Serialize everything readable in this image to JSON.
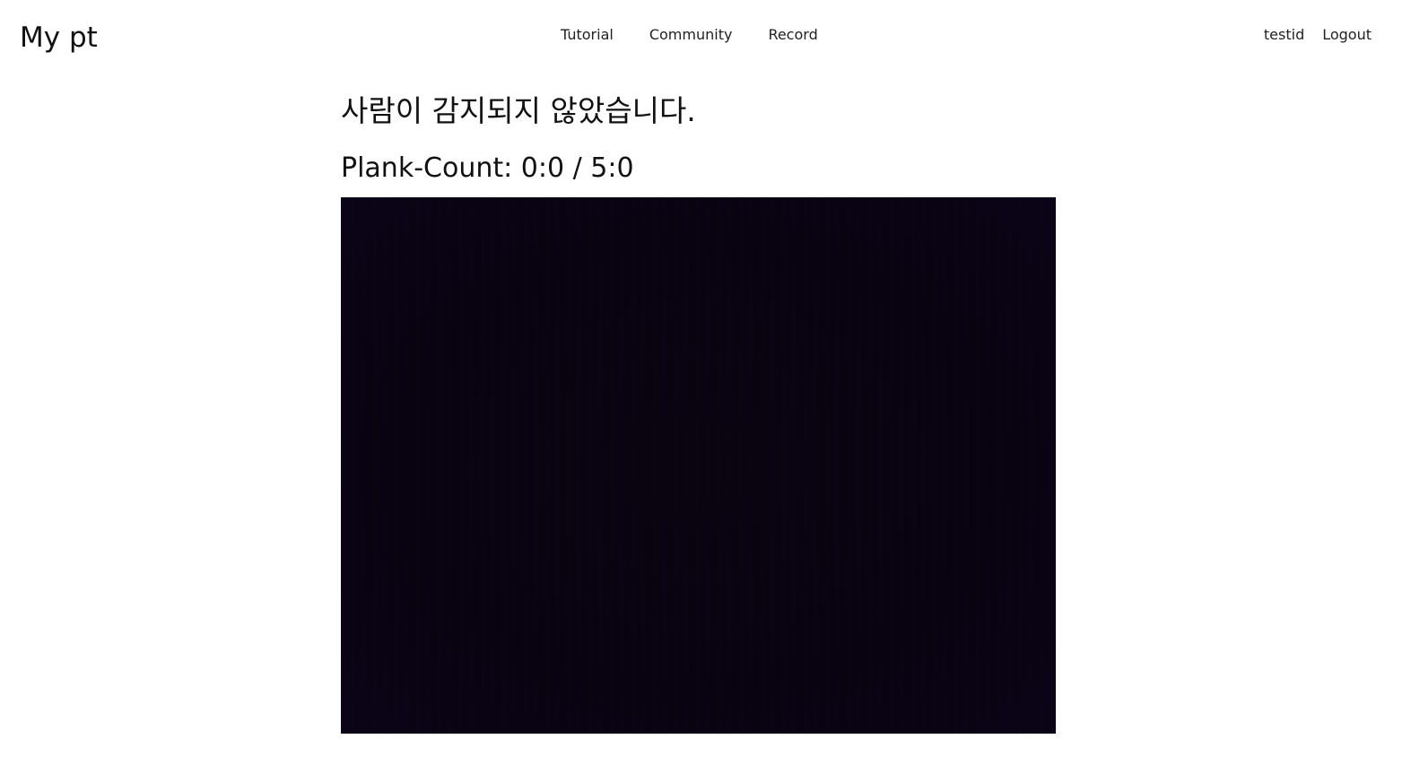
{
  "navbar": {
    "brand": "My pt",
    "links": [
      {
        "label": "Tutorial"
      },
      {
        "label": "Community"
      },
      {
        "label": "Record"
      }
    ],
    "user": {
      "username": "testid",
      "logout_label": "Logout"
    }
  },
  "main": {
    "status_message": "사람이 감지되지 않았습니다.",
    "counter": {
      "label": "Plank-Count:",
      "current": "0:0",
      "separator": "/",
      "target": "5:0"
    }
  },
  "colors": {
    "background": "#ffffff",
    "text": "#111111",
    "video_background": "#080210"
  }
}
